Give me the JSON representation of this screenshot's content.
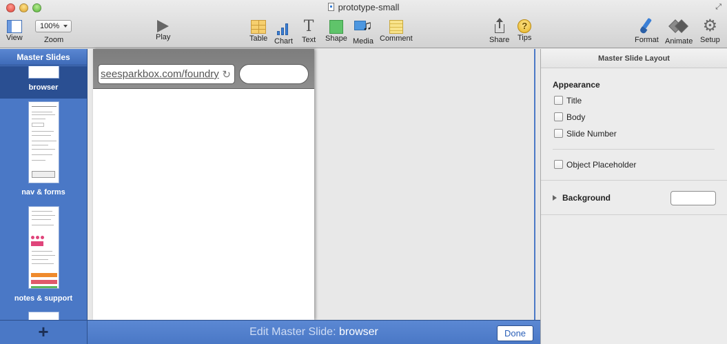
{
  "window": {
    "title": "prototype-small"
  },
  "toolbar": {
    "view_label": "View",
    "zoom_value": "100%",
    "zoom_label": "Zoom",
    "play_label": "Play",
    "table_label": "Table",
    "chart_label": "Chart",
    "text_label": "Text",
    "shape_label": "Shape",
    "media_label": "Media",
    "comment_label": "Comment",
    "share_label": "Share",
    "tips_label": "Tips",
    "tips_glyph": "?",
    "format_label": "Format",
    "animate_label": "Animate",
    "setup_label": "Setup"
  },
  "master_panel": {
    "title": "Master Slides",
    "add_glyph": "+",
    "items": [
      {
        "caption": "browser",
        "selected": true
      },
      {
        "caption": "nav & forms",
        "selected": false
      },
      {
        "caption": "notes & support",
        "selected": false
      }
    ]
  },
  "slide": {
    "url": "seesparkbox.com/foundry",
    "reload_glyph": "↻"
  },
  "edit_bar": {
    "prefix": "Edit Master Slide:",
    "slide_name": "browser",
    "done_label": "Done"
  },
  "inspector": {
    "header": "Master Slide Layout",
    "appearance_title": "Appearance",
    "checks": [
      {
        "label": "Title",
        "checked": false
      },
      {
        "label": "Body",
        "checked": false
      },
      {
        "label": "Slide Number",
        "checked": false
      }
    ],
    "object_placeholder": {
      "label": "Object Placeholder",
      "checked": false
    },
    "background_label": "Background"
  },
  "colors": {
    "panel_blue": "#4a78c6",
    "selected_blue": "#2a4f92",
    "done_text": "#2a5fb8"
  }
}
